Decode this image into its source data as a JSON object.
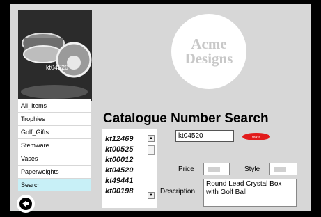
{
  "photo": {
    "caption": "kt04520"
  },
  "logo": {
    "line1": "Acme",
    "line2": "Designs"
  },
  "nav": {
    "items": [
      {
        "label": "All_Items"
      },
      {
        "label": "Trophies"
      },
      {
        "label": "Golf_Gifts"
      },
      {
        "label": "Stemware"
      },
      {
        "label": "Vases"
      },
      {
        "label": "Paperweights"
      },
      {
        "label": "Search",
        "active": true
      }
    ]
  },
  "search": {
    "title": "Catalogue Number Search",
    "input_value": "kt04520",
    "go_label": "search",
    "results": [
      "kt12469",
      "kt00525",
      "kt00012",
      "kt04520",
      "kt49441",
      "kt00198"
    ]
  },
  "details": {
    "price_label": "Price",
    "style_label": "Style",
    "description_label": "Description",
    "description_value": "Round Lead Crystal Box with Golf Ball"
  },
  "colors": {
    "panel": "#d7d7d7",
    "accent": "#e21b1b",
    "nav_active": "#c8f0f7"
  }
}
